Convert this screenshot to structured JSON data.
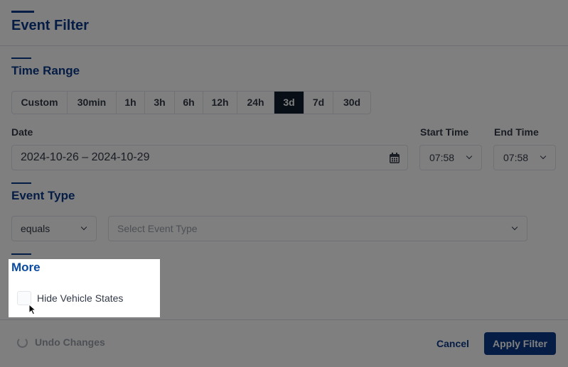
{
  "header": {
    "title": "Event Filter"
  },
  "time_range": {
    "title": "Time Range",
    "options": [
      "Custom",
      "30min",
      "1h",
      "3h",
      "6h",
      "12h",
      "24h",
      "3d",
      "7d",
      "30d"
    ],
    "selected": "3d"
  },
  "date": {
    "label": "Date",
    "value": "2024-10-26 – 2024-10-29",
    "icon": "calendar-icon"
  },
  "start_time": {
    "label": "Start Time",
    "value": "07:58"
  },
  "end_time": {
    "label": "End Time",
    "value": "07:58"
  },
  "event_type": {
    "title": "Event Type",
    "operator": "equals",
    "placeholder": "Select Event Type"
  },
  "more": {
    "title": "More",
    "hide_vehicle_states_label": "Hide Vehicle States",
    "hide_vehicle_states_checked": false
  },
  "footer": {
    "undo_label": "Undo Changes",
    "cancel_label": "Cancel",
    "apply_label": "Apply Filter"
  },
  "colors": {
    "accent": "#0a3a8a",
    "active_segment": "#101c2c",
    "primary_button": "#0a3a8a"
  }
}
